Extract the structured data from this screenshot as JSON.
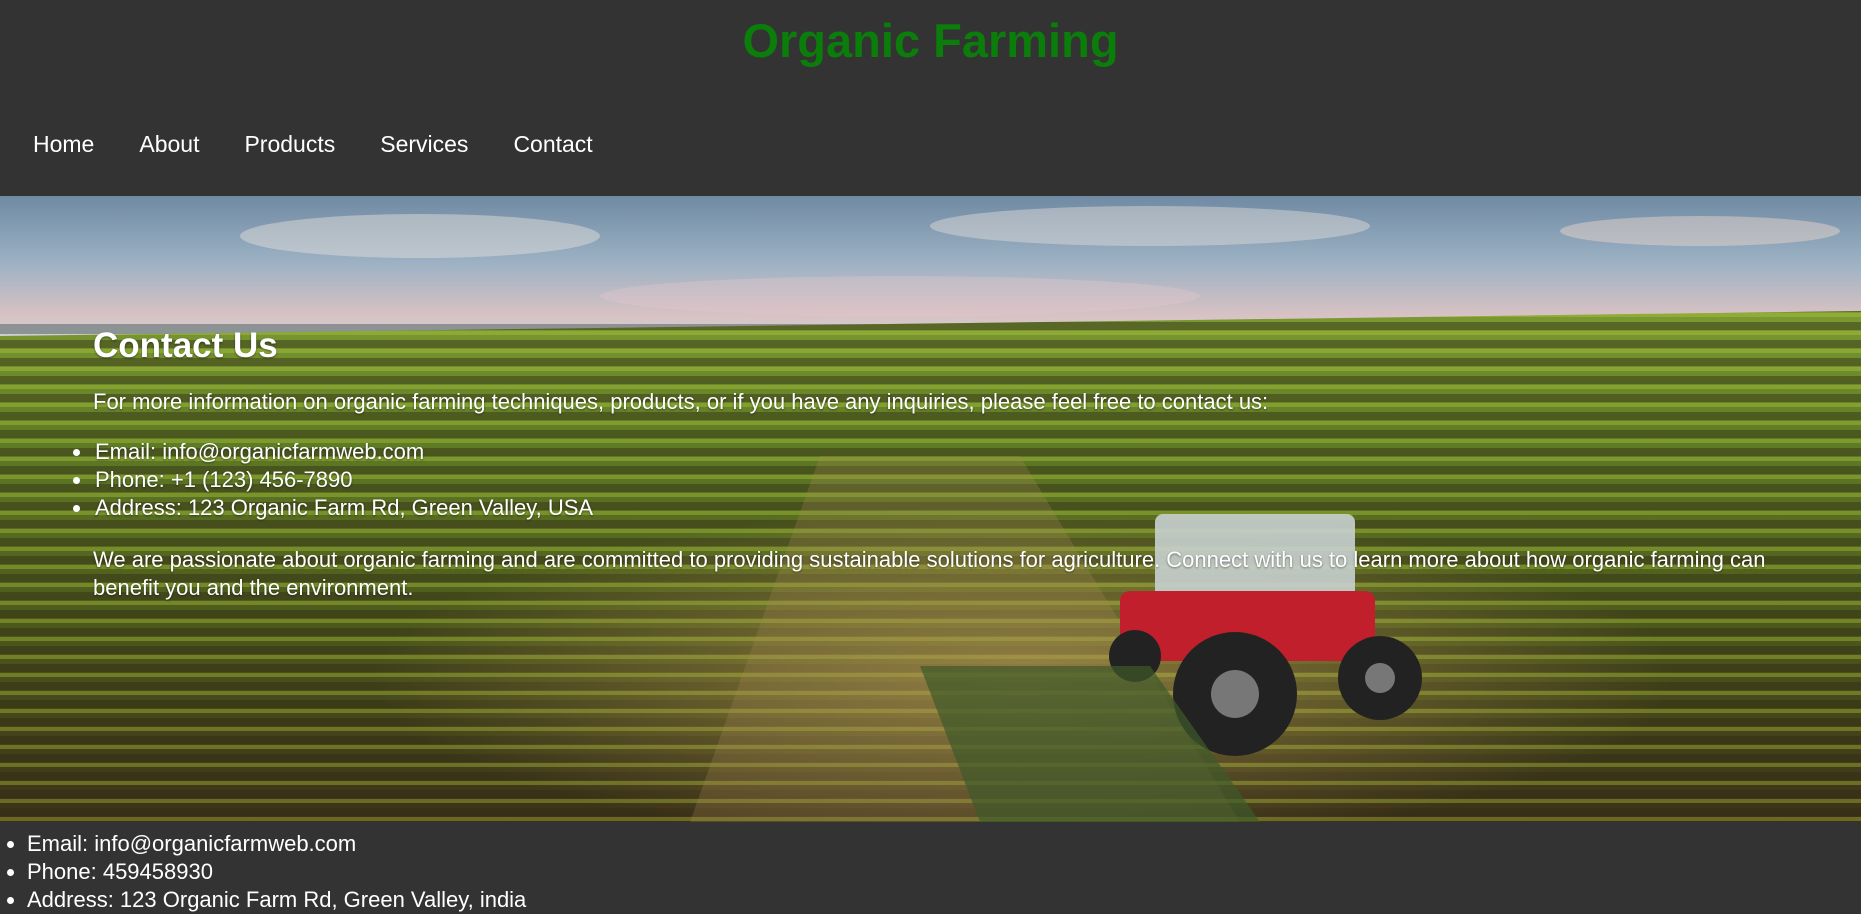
{
  "header": {
    "title": "Organic Farming",
    "title_color": "#0a7d0a",
    "nav": [
      "Home",
      "About",
      "Products",
      "Services",
      "Contact"
    ]
  },
  "hero": {
    "heading": "Contact Us",
    "intro": "For more information on organic farming techniques, products, or if you have any inquiries, please feel free to contact us:",
    "contacts": [
      "Email: info@organicfarmweb.com",
      "Phone: +1 (123) 456-7890",
      "Address: 123 Organic Farm Rd, Green Valley, USA"
    ],
    "closing": "We are passionate about organic farming and are committed to providing sustainable solutions for agriculture. Connect with us to learn more about how organic farming can benefit you and the environment.",
    "background_image": "tractor-field-image"
  },
  "footer": {
    "contacts": [
      "Email: info@organicfarmweb.com",
      "Phone: 459458930",
      "Address: 123 Organic Farm Rd, Green Valley, india"
    ]
  },
  "colors": {
    "background": "#333333",
    "text": "#ffffff",
    "title": "#0a7d0a"
  }
}
